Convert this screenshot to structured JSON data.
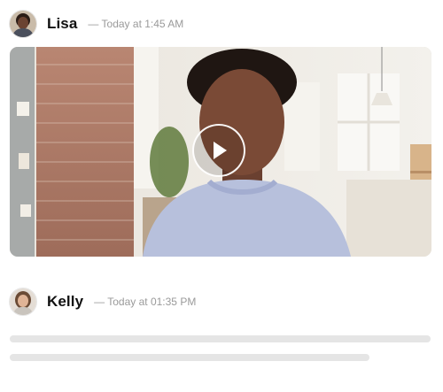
{
  "messages": [
    {
      "author": "Lisa",
      "timestamp": "— Today at 1:45 AM",
      "attachment": {
        "type": "video",
        "state": "paused",
        "play_icon": "play-icon"
      }
    },
    {
      "author": "Kelly",
      "timestamp": "— Today at 01:35 PM",
      "body_state": "loading"
    }
  ],
  "colors": {
    "skeleton": "#e5e5e5",
    "timestamp": "#9a9a9a",
    "author": "#111111"
  }
}
